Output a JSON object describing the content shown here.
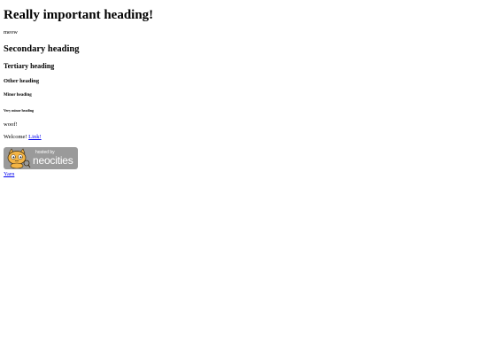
{
  "headings": {
    "h1": "Really important heading!",
    "h2": "Secondary heading",
    "h3": "Tertiary heading",
    "h4": "Other heading",
    "h5": "Minor heading",
    "h6": "Very minor heading"
  },
  "paragraphs": {
    "meow": "meow",
    "woof": "woof!",
    "welcome": "Welcome! ",
    "link": "Link!"
  },
  "banner": {
    "hosted_by": "hosted by",
    "brand": "neocities"
  },
  "footer_link": "Yarn",
  "colors": {
    "link": "#0000ee",
    "banner_bg": "#9a9a9a"
  },
  "icons": {
    "banner_mascot": "neocities-cat-icon"
  }
}
